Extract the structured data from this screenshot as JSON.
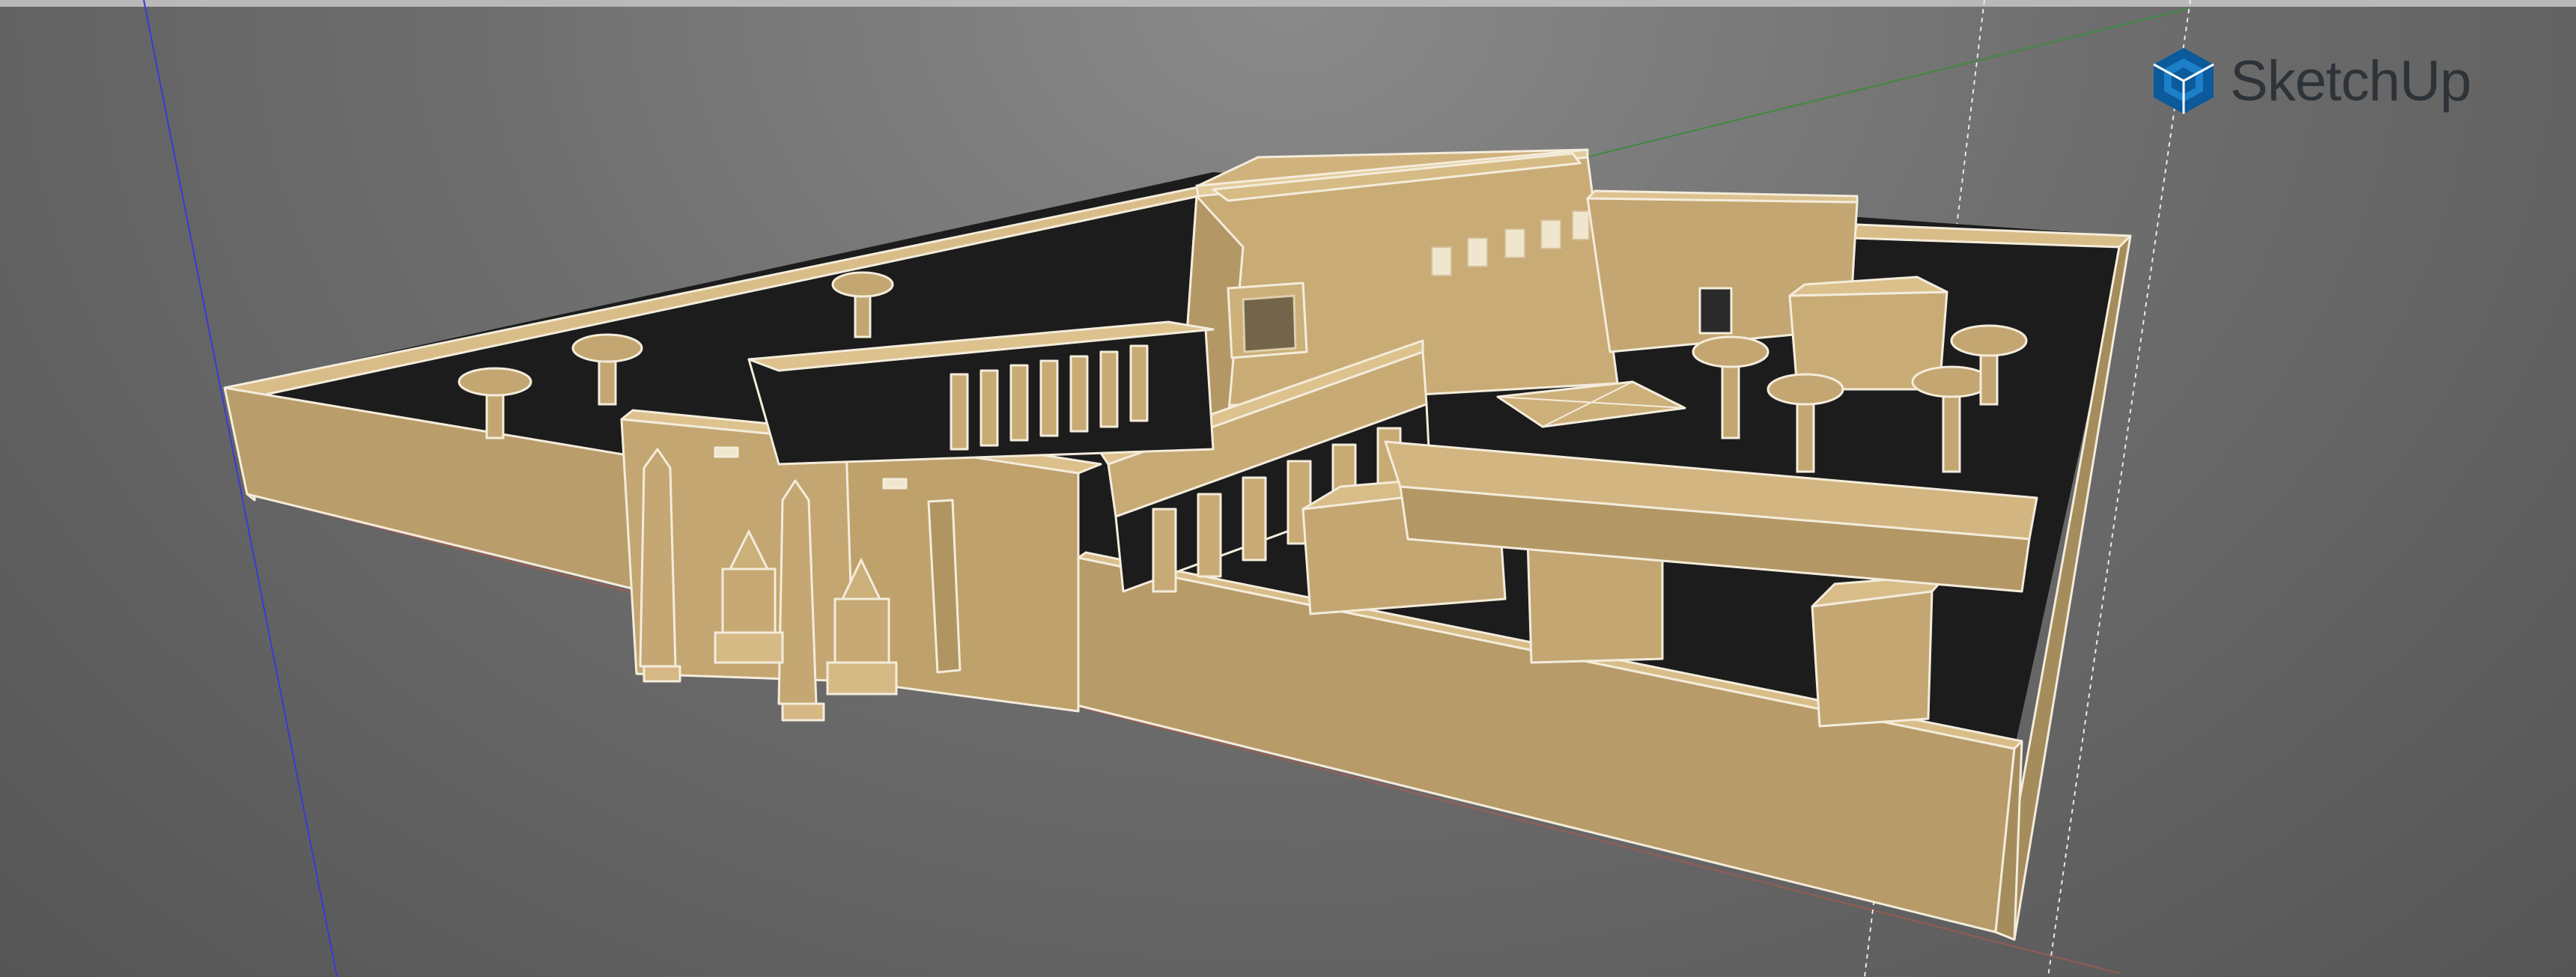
{
  "app": {
    "brand_name": "SketchUp",
    "brand_icon": "sketchup-logo-icon",
    "brand_color": "#0a5a9c"
  },
  "viewport": {
    "background_color": "#6e6e6e",
    "model_fill_color": "#cdb07c",
    "model_shadow_color": "#1c1c1c",
    "model_edge_color": "#f4ecdc",
    "axis_colors": {
      "blue": "#3a3ad6",
      "green": "#3e8a3e",
      "red": "#b8584a"
    },
    "guide_line_color": "#e8e8e8"
  }
}
